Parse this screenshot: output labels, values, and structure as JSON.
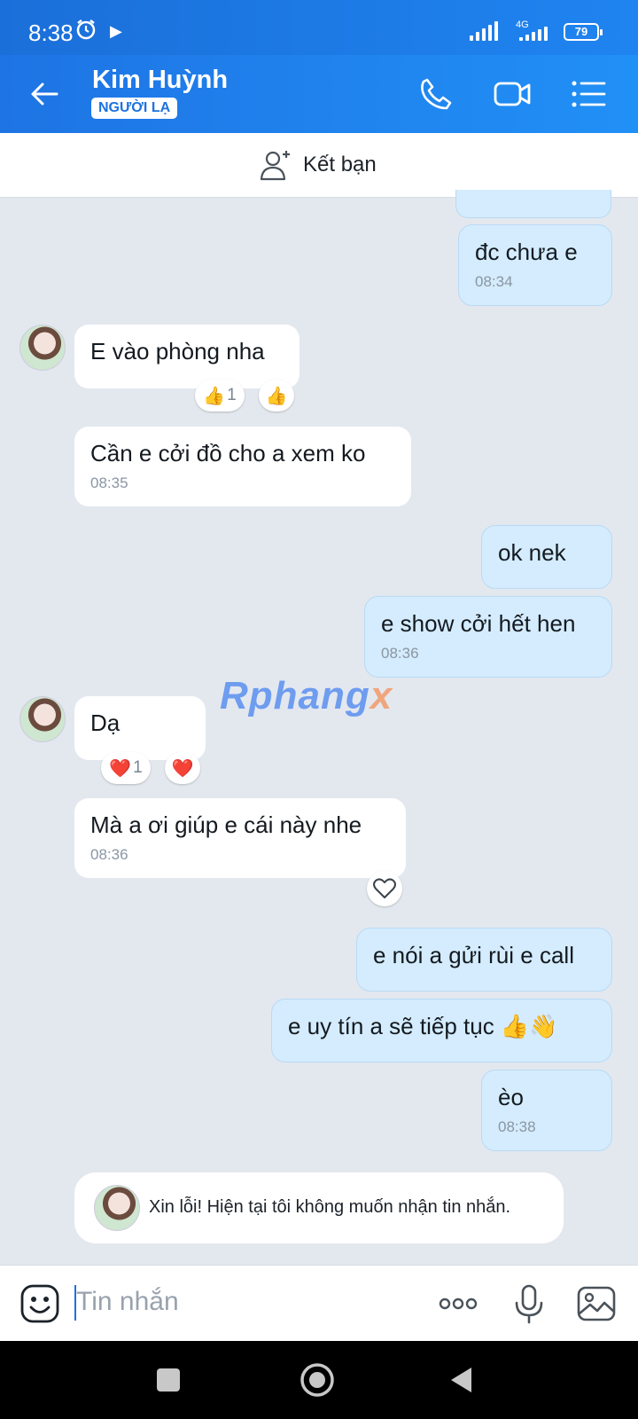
{
  "status_bar": {
    "time": "8:38",
    "network": "4G",
    "battery": "79"
  },
  "header": {
    "contact_name": "Kim Huỳnh",
    "badge": "NGƯỜI LẠ"
  },
  "add_friend": {
    "label": "Kết bạn"
  },
  "messages": [
    {
      "side": "sent",
      "text": "đc chưa e",
      "time": "08:34"
    },
    {
      "side": "recv",
      "text": "E vào phòng nha",
      "reaction": {
        "emoji": "👍",
        "count": "1"
      },
      "my_reaction": "👍"
    },
    {
      "side": "recv",
      "text": "Cần e cởi đồ cho a xem ko",
      "time": "08:35"
    },
    {
      "side": "sent",
      "text": "ok nek"
    },
    {
      "side": "sent",
      "text": "e show cởi hết hen",
      "time": "08:36"
    },
    {
      "side": "recv",
      "text": "Dạ",
      "reaction": {
        "emoji": "❤️",
        "count": "1"
      },
      "my_reaction": "❤️"
    },
    {
      "side": "recv",
      "text": "Mà a ơi giúp e cái này nhe",
      "time": "08:36"
    },
    {
      "side": "sent",
      "text": "e nói a gửi rùi e call"
    },
    {
      "side": "sent",
      "text": "e uy tín a sẽ tiếp tục 👍👋"
    },
    {
      "side": "sent",
      "text": "èo",
      "time": "08:38"
    }
  ],
  "watermark": {
    "main": "Rphang",
    "accent": "x"
  },
  "notice": {
    "text": "Xin lỗi! Hiện tại tôi không muốn nhận tin nhắn."
  },
  "input": {
    "placeholder": "Tin nhắn"
  },
  "colors": {
    "header_blue": "#1e74e4",
    "sent_bubble": "#d4ecfd",
    "chat_bg": "#e3e8ef"
  }
}
